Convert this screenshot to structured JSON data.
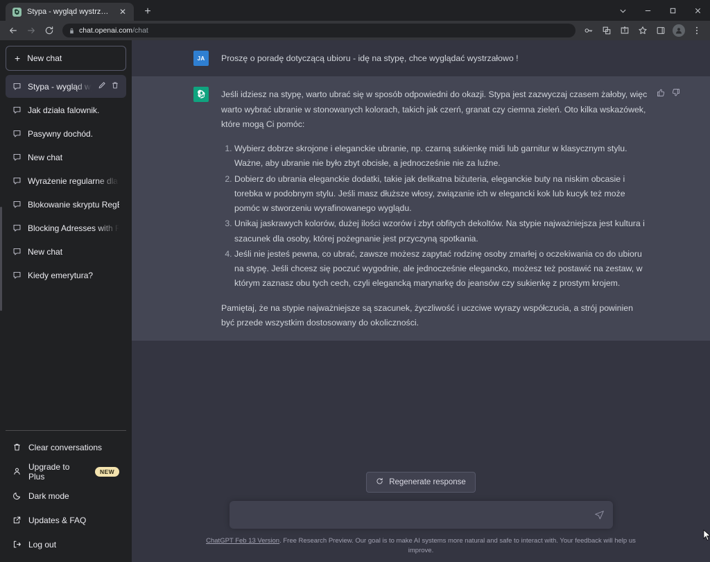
{
  "browser": {
    "tab": {
      "title": "Stypa - wygląd wystrzałowy!",
      "favicon_name": "chatgpt-favicon",
      "close_label": "✕"
    },
    "new_tab_label": "+",
    "window_controls": [
      "chevron-down",
      "minimize",
      "maximize",
      "close"
    ],
    "nav": {
      "back_label": "←",
      "forward_label": "→",
      "reload_label": "⟳"
    },
    "omnibox": {
      "lock_icon": "lock-icon",
      "domain": "chat.openai.com",
      "path": "/chat"
    },
    "toolbar_icons": [
      "key-icon",
      "extensions-icon",
      "share-icon",
      "bookmark-star-icon",
      "side-panel-icon",
      "profile-avatar-icon",
      "browser-menu-icon"
    ]
  },
  "sidebar": {
    "new_chat_label": "New chat",
    "conversations": [
      {
        "label": "Stypa - wygląd wystrzał",
        "active": true,
        "truncated": true
      },
      {
        "label": "Jak działa falownik.",
        "active": false,
        "truncated": false
      },
      {
        "label": "Pasywny dochód.",
        "active": false,
        "truncated": false
      },
      {
        "label": "New chat",
        "active": false,
        "truncated": false
      },
      {
        "label": "Wyrażenie regularne dla bloka",
        "active": false,
        "truncated": true
      },
      {
        "label": "Blokowanie skryptu RegEx",
        "active": false,
        "truncated": false
      },
      {
        "label": "Blocking Adresses with RegEx",
        "active": false,
        "truncated": true
      },
      {
        "label": "New chat",
        "active": false,
        "truncated": false
      },
      {
        "label": "Kiedy emerytura?",
        "active": false,
        "truncated": false
      }
    ],
    "footer": [
      {
        "label": "Clear conversations",
        "icon": "trash-icon",
        "badge": null
      },
      {
        "label": "Upgrade to Plus",
        "icon": "person-icon",
        "badge": "NEW"
      },
      {
        "label": "Dark mode",
        "icon": "moon-icon",
        "badge": null
      },
      {
        "label": "Updates & FAQ",
        "icon": "external-link-icon",
        "badge": null
      },
      {
        "label": "Log out",
        "icon": "logout-icon",
        "badge": null
      }
    ]
  },
  "chat": {
    "user_message": {
      "avatar_initials": "JA",
      "text": "Proszę o poradę dotyczącą ubioru - idę na stypę, chce wyglądać wystrzałowo !"
    },
    "assistant_message": {
      "avatar_name": "chatgpt-logo",
      "intro": "Jeśli idziesz na stypę, warto ubrać się w sposób odpowiedni do okazji. Stypa jest zazwyczaj czasem żałoby, więc warto wybrać ubranie w stonowanych kolorach, takich jak czerń, granat czy ciemna zieleń. Oto kilka wskazówek, które mogą Ci pomóc:",
      "list": [
        "Wybierz dobrze skrojone i eleganckie ubranie, np. czarną sukienkę midi lub garnitur w klasycznym stylu. Ważne, aby ubranie nie było zbyt obcisłe, a jednocześnie nie za luźne.",
        "Dobierz do ubrania eleganckie dodatki, takie jak delikatna biżuteria, eleganckie buty na niskim obcasie i torebka w podobnym stylu. Jeśli masz dłuższe włosy, związanie ich w elegancki kok lub kucyk też może pomóc w stworzeniu wyrafinowanego wyglądu.",
        "Unikaj jaskrawych kolorów, dużej ilości wzorów i zbyt obfitych dekoltów. Na stypie najważniejsza jest kultura i szacunek dla osoby, której pożegnanie jest przyczyną spotkania.",
        "Jeśli nie jesteś pewna, co ubrać, zawsze możesz zapytać rodzinę osoby zmarłej o oczekiwania co do ubioru na stypę. Jeśli chcesz się poczuć wygodnie, ale jednocześnie elegancko, możesz też postawić na zestaw, w którym zaznasz obu tych cech, czyli elegancką marynarkę do jeansów czy sukienkę z prostym krojem."
      ],
      "outro": "Pamiętaj, że na stypie najważniejsze są szacunek, życzliwość i uczciwe wyrazy współczucia, a strój powinien być przede wszystkim dostosowany do okoliczności.",
      "feedback_icons": [
        "thumbs-up-icon",
        "thumbs-down-icon"
      ]
    }
  },
  "composer": {
    "regenerate_label": "Regenerate response",
    "input_value": "",
    "input_placeholder": "",
    "send_icon": "send-icon"
  },
  "footer": {
    "version_link": "ChatGPT Feb 13 Version",
    "disclaimer": ". Free Research Preview. Our goal is to make AI systems more natural and safe to interact with. Your feedback will help us improve."
  },
  "colors": {
    "accent_green": "#10a37f",
    "user_avatar_blue": "#2f7fd1",
    "sidebar_bg": "#202123",
    "user_msg_bg": "#343541",
    "assistant_msg_bg": "#444654",
    "badge_new_bg": "#f3e3ae"
  }
}
